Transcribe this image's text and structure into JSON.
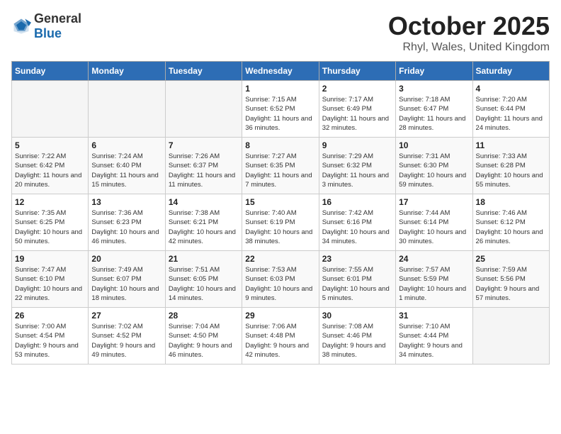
{
  "header": {
    "logo_general": "General",
    "logo_blue": "Blue",
    "title": "October 2025",
    "subtitle": "Rhyl, Wales, United Kingdom"
  },
  "weekdays": [
    "Sunday",
    "Monday",
    "Tuesday",
    "Wednesday",
    "Thursday",
    "Friday",
    "Saturday"
  ],
  "weeks": [
    [
      {
        "day": "",
        "sunrise": "",
        "sunset": "",
        "daylight": ""
      },
      {
        "day": "",
        "sunrise": "",
        "sunset": "",
        "daylight": ""
      },
      {
        "day": "",
        "sunrise": "",
        "sunset": "",
        "daylight": ""
      },
      {
        "day": "1",
        "sunrise": "Sunrise: 7:15 AM",
        "sunset": "Sunset: 6:52 PM",
        "daylight": "Daylight: 11 hours and 36 minutes."
      },
      {
        "day": "2",
        "sunrise": "Sunrise: 7:17 AM",
        "sunset": "Sunset: 6:49 PM",
        "daylight": "Daylight: 11 hours and 32 minutes."
      },
      {
        "day": "3",
        "sunrise": "Sunrise: 7:18 AM",
        "sunset": "Sunset: 6:47 PM",
        "daylight": "Daylight: 11 hours and 28 minutes."
      },
      {
        "day": "4",
        "sunrise": "Sunrise: 7:20 AM",
        "sunset": "Sunset: 6:44 PM",
        "daylight": "Daylight: 11 hours and 24 minutes."
      }
    ],
    [
      {
        "day": "5",
        "sunrise": "Sunrise: 7:22 AM",
        "sunset": "Sunset: 6:42 PM",
        "daylight": "Daylight: 11 hours and 20 minutes."
      },
      {
        "day": "6",
        "sunrise": "Sunrise: 7:24 AM",
        "sunset": "Sunset: 6:40 PM",
        "daylight": "Daylight: 11 hours and 15 minutes."
      },
      {
        "day": "7",
        "sunrise": "Sunrise: 7:26 AM",
        "sunset": "Sunset: 6:37 PM",
        "daylight": "Daylight: 11 hours and 11 minutes."
      },
      {
        "day": "8",
        "sunrise": "Sunrise: 7:27 AM",
        "sunset": "Sunset: 6:35 PM",
        "daylight": "Daylight: 11 hours and 7 minutes."
      },
      {
        "day": "9",
        "sunrise": "Sunrise: 7:29 AM",
        "sunset": "Sunset: 6:32 PM",
        "daylight": "Daylight: 11 hours and 3 minutes."
      },
      {
        "day": "10",
        "sunrise": "Sunrise: 7:31 AM",
        "sunset": "Sunset: 6:30 PM",
        "daylight": "Daylight: 10 hours and 59 minutes."
      },
      {
        "day": "11",
        "sunrise": "Sunrise: 7:33 AM",
        "sunset": "Sunset: 6:28 PM",
        "daylight": "Daylight: 10 hours and 55 minutes."
      }
    ],
    [
      {
        "day": "12",
        "sunrise": "Sunrise: 7:35 AM",
        "sunset": "Sunset: 6:25 PM",
        "daylight": "Daylight: 10 hours and 50 minutes."
      },
      {
        "day": "13",
        "sunrise": "Sunrise: 7:36 AM",
        "sunset": "Sunset: 6:23 PM",
        "daylight": "Daylight: 10 hours and 46 minutes."
      },
      {
        "day": "14",
        "sunrise": "Sunrise: 7:38 AM",
        "sunset": "Sunset: 6:21 PM",
        "daylight": "Daylight: 10 hours and 42 minutes."
      },
      {
        "day": "15",
        "sunrise": "Sunrise: 7:40 AM",
        "sunset": "Sunset: 6:19 PM",
        "daylight": "Daylight: 10 hours and 38 minutes."
      },
      {
        "day": "16",
        "sunrise": "Sunrise: 7:42 AM",
        "sunset": "Sunset: 6:16 PM",
        "daylight": "Daylight: 10 hours and 34 minutes."
      },
      {
        "day": "17",
        "sunrise": "Sunrise: 7:44 AM",
        "sunset": "Sunset: 6:14 PM",
        "daylight": "Daylight: 10 hours and 30 minutes."
      },
      {
        "day": "18",
        "sunrise": "Sunrise: 7:46 AM",
        "sunset": "Sunset: 6:12 PM",
        "daylight": "Daylight: 10 hours and 26 minutes."
      }
    ],
    [
      {
        "day": "19",
        "sunrise": "Sunrise: 7:47 AM",
        "sunset": "Sunset: 6:10 PM",
        "daylight": "Daylight: 10 hours and 22 minutes."
      },
      {
        "day": "20",
        "sunrise": "Sunrise: 7:49 AM",
        "sunset": "Sunset: 6:07 PM",
        "daylight": "Daylight: 10 hours and 18 minutes."
      },
      {
        "day": "21",
        "sunrise": "Sunrise: 7:51 AM",
        "sunset": "Sunset: 6:05 PM",
        "daylight": "Daylight: 10 hours and 14 minutes."
      },
      {
        "day": "22",
        "sunrise": "Sunrise: 7:53 AM",
        "sunset": "Sunset: 6:03 PM",
        "daylight": "Daylight: 10 hours and 9 minutes."
      },
      {
        "day": "23",
        "sunrise": "Sunrise: 7:55 AM",
        "sunset": "Sunset: 6:01 PM",
        "daylight": "Daylight: 10 hours and 5 minutes."
      },
      {
        "day": "24",
        "sunrise": "Sunrise: 7:57 AM",
        "sunset": "Sunset: 5:59 PM",
        "daylight": "Daylight: 10 hours and 1 minute."
      },
      {
        "day": "25",
        "sunrise": "Sunrise: 7:59 AM",
        "sunset": "Sunset: 5:56 PM",
        "daylight": "Daylight: 9 hours and 57 minutes."
      }
    ],
    [
      {
        "day": "26",
        "sunrise": "Sunrise: 7:00 AM",
        "sunset": "Sunset: 4:54 PM",
        "daylight": "Daylight: 9 hours and 53 minutes."
      },
      {
        "day": "27",
        "sunrise": "Sunrise: 7:02 AM",
        "sunset": "Sunset: 4:52 PM",
        "daylight": "Daylight: 9 hours and 49 minutes."
      },
      {
        "day": "28",
        "sunrise": "Sunrise: 7:04 AM",
        "sunset": "Sunset: 4:50 PM",
        "daylight": "Daylight: 9 hours and 46 minutes."
      },
      {
        "day": "29",
        "sunrise": "Sunrise: 7:06 AM",
        "sunset": "Sunset: 4:48 PM",
        "daylight": "Daylight: 9 hours and 42 minutes."
      },
      {
        "day": "30",
        "sunrise": "Sunrise: 7:08 AM",
        "sunset": "Sunset: 4:46 PM",
        "daylight": "Daylight: 9 hours and 38 minutes."
      },
      {
        "day": "31",
        "sunrise": "Sunrise: 7:10 AM",
        "sunset": "Sunset: 4:44 PM",
        "daylight": "Daylight: 9 hours and 34 minutes."
      },
      {
        "day": "",
        "sunrise": "",
        "sunset": "",
        "daylight": ""
      }
    ]
  ]
}
